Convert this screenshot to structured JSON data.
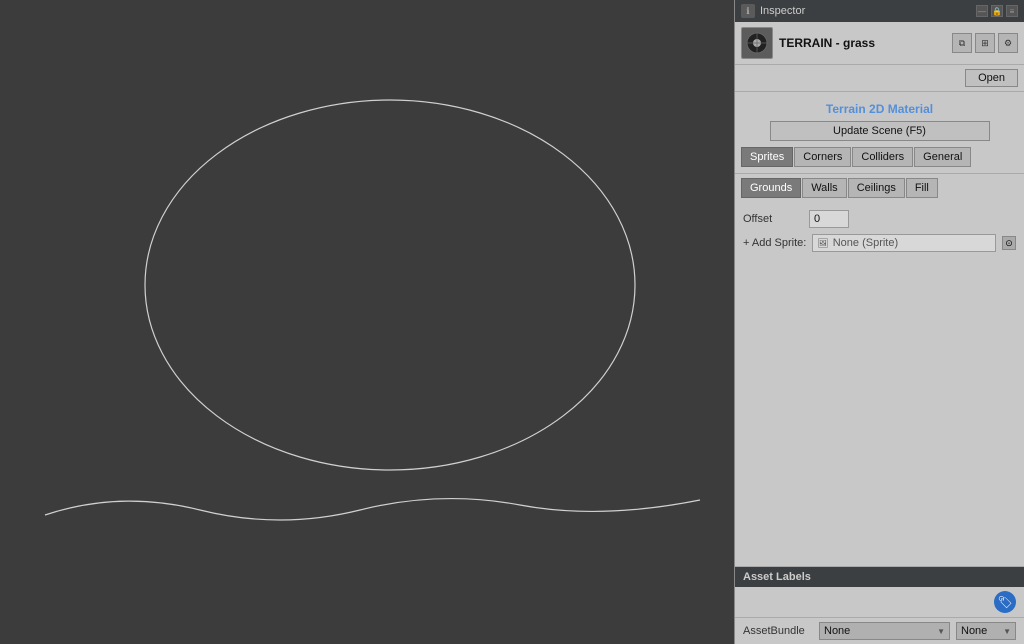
{
  "canvas": {
    "background_color": "#3c3c3c"
  },
  "inspector": {
    "title": "Inspector",
    "title_icon": "ℹ",
    "window_controls": [
      "—",
      "□",
      "✕"
    ],
    "asset": {
      "name": "TERRAIN - grass",
      "icon_label": "unity-logo"
    },
    "header_buttons": [
      "copy-icon",
      "settings-icon",
      "gear-icon"
    ],
    "open_button": "Open",
    "section_title": "Terrain 2D Material",
    "update_scene_button": "Update Scene (F5)",
    "tabs1": [
      {
        "label": "Sprites",
        "active": true
      },
      {
        "label": "Corners",
        "active": false
      },
      {
        "label": "Colliders",
        "active": false
      },
      {
        "label": "General",
        "active": false
      }
    ],
    "tabs2": [
      {
        "label": "Grounds",
        "active": true
      },
      {
        "label": "Walls",
        "active": false
      },
      {
        "label": "Ceilings",
        "active": false
      },
      {
        "label": "Fill",
        "active": false
      }
    ],
    "fields": {
      "offset_label": "Offset",
      "offset_value": "0",
      "add_sprite_label": "+ Add Sprite:",
      "sprite_value": "None (Sprite)"
    },
    "asset_labels": {
      "title": "Asset Labels",
      "bundle_label": "AssetBundle",
      "bundle_value": "None",
      "bundle_value2": "None"
    }
  }
}
